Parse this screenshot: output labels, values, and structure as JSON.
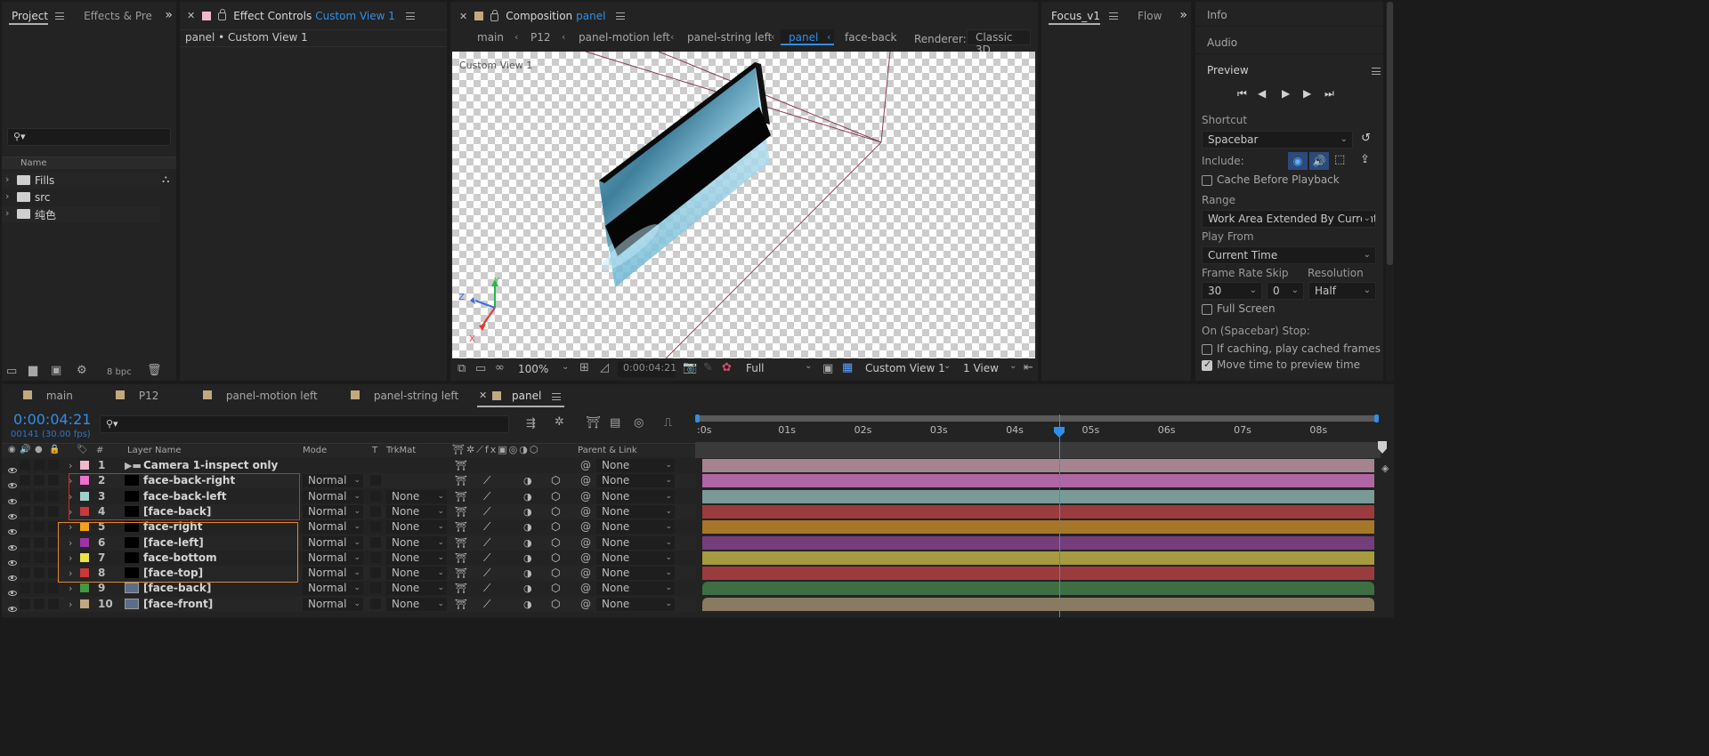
{
  "project_panel": {
    "tabs": [
      {
        "label": "Project",
        "active": true
      },
      {
        "label": "Effects & Pre",
        "active": false
      }
    ],
    "overflow": "»",
    "search_placeholder": "",
    "column_header": "Name",
    "items": [
      {
        "label": "Fills"
      },
      {
        "label": "src"
      },
      {
        "label": "纯色"
      }
    ],
    "bpc": "8 bpc"
  },
  "effect_controls": {
    "title": "Effect Controls",
    "title_target": "Custom View 1",
    "subheader": "panel • Custom View 1",
    "swatch_color": "#f0b7cf"
  },
  "composition": {
    "title": "Composition",
    "title_target": "panel",
    "breadcrumbs": [
      "main",
      "P12",
      "panel-motion left",
      "panel-string left",
      "panel",
      "face-back"
    ],
    "breadcrumb_ellipsis": "..",
    "renderer_label": "Renderer:",
    "renderer_value": "Classic 3D",
    "viewport_label": "Custom View 1",
    "axis_labels": {
      "z": "Z",
      "y": "Y",
      "x": "X"
    },
    "footer": {
      "zoom": "100%",
      "timecode": "0:00:04:21",
      "resolution": "Full",
      "view": "Custom View 1",
      "layout": "1 View"
    }
  },
  "focus_panel": {
    "tabs": [
      {
        "label": "Focus_v1",
        "active": true
      },
      {
        "label": "Flow",
        "active": false
      }
    ],
    "overflow": "»"
  },
  "right_panel": {
    "sections": [
      "Info",
      "Audio",
      "Preview"
    ],
    "shortcut_label": "Shortcut",
    "shortcut_value": "Spacebar",
    "include_label": "Include:",
    "cache_before_playback": "Cache Before Playback",
    "range_label": "Range",
    "range_value": "Work Area Extended By Current...",
    "play_from_label": "Play From",
    "play_from_value": "Current Time",
    "frame_rate_label": "Frame Rate",
    "frame_rate_value": "30",
    "skip_label": "Skip",
    "skip_value": "0",
    "resolution_label": "Resolution",
    "resolution_value": "Half",
    "full_screen": "Full Screen",
    "stop_label": "On (Spacebar) Stop:",
    "if_caching": "If caching, play cached frames",
    "move_time": "Move time to preview time"
  },
  "timeline": {
    "tabs": [
      {
        "label": "main",
        "color": "#c3a87e"
      },
      {
        "label": "P12",
        "color": "#c3a87e"
      },
      {
        "label": "panel-motion left",
        "color": "#c3a87e"
      },
      {
        "label": "panel-string left",
        "color": "#c3a87e"
      },
      {
        "label": "panel",
        "color": "#c3a87e",
        "active": true
      }
    ],
    "timecode": "0:00:04:21",
    "frames": "00141 (30.00 fps)",
    "columns": {
      "num": "#",
      "layer_name": "Layer Name",
      "mode": "Mode",
      "t": "T",
      "trkmat": "TrkMat",
      "parent": "Parent & Link"
    },
    "ruler": [
      "0s",
      "01s",
      "02s",
      "03s",
      "04s",
      "05s",
      "06s",
      "07s",
      "08s"
    ],
    "ruler_zero_prefix": ":",
    "playhead_seconds": 4.7,
    "layers": [
      {
        "num": "1",
        "name": "Camera 1-inspect only",
        "color": "#f0b7cf",
        "kind": "camera",
        "mode": "",
        "trkmat": "",
        "parent": "None",
        "bar_color": "#a6848f"
      },
      {
        "num": "2",
        "name": "face-back-right",
        "color": "#ee6fd1",
        "kind": "solid",
        "mode": "Normal",
        "trkmat": "",
        "parent": "None",
        "bar_color": "#b066a4"
      },
      {
        "num": "3",
        "name": "face-back-left",
        "color": "#9fd1cc",
        "kind": "solid",
        "mode": "Normal",
        "trkmat": "None",
        "parent": "None",
        "bar_color": "#7a9a97"
      },
      {
        "num": "4",
        "name": "[face-back]",
        "color": "#c9383a",
        "kind": "solid",
        "mode": "Normal",
        "trkmat": "None",
        "parent": "None",
        "bar_color": "#9a3c3e"
      },
      {
        "num": "5",
        "name": "face-right",
        "color": "#f4a01b",
        "kind": "solid",
        "mode": "Normal",
        "trkmat": "None",
        "parent": "None",
        "bar_color": "#a6762a"
      },
      {
        "num": "6",
        "name": "[face-left]",
        "color": "#9e33a7",
        "kind": "solid",
        "mode": "Normal",
        "trkmat": "None",
        "parent": "None",
        "bar_color": "#743e7b"
      },
      {
        "num": "7",
        "name": "face-bottom",
        "color": "#ece346",
        "kind": "solid",
        "mode": "Normal",
        "trkmat": "None",
        "parent": "None",
        "bar_color": "#a69b3e"
      },
      {
        "num": "8",
        "name": "[face-top]",
        "color": "#c9383a",
        "kind": "solid",
        "mode": "Normal",
        "trkmat": "None",
        "parent": "None",
        "bar_color": "#9a3c3e"
      },
      {
        "num": "9",
        "name": "[face-back]",
        "color": "#3f9a46",
        "kind": "comp",
        "mode": "Normal",
        "trkmat": "None",
        "parent": "None",
        "bar_color": "#3e6e43"
      },
      {
        "num": "10",
        "name": "[face-front]",
        "color": "#c3a87e",
        "kind": "comp",
        "mode": "Normal",
        "trkmat": "None",
        "parent": "None",
        "bar_color": "#8a7a62"
      }
    ]
  },
  "colors": {
    "accent_blue": "#2f8fe8",
    "highlight_red": "#c6302c",
    "highlight_orange": "#e08b2c"
  }
}
